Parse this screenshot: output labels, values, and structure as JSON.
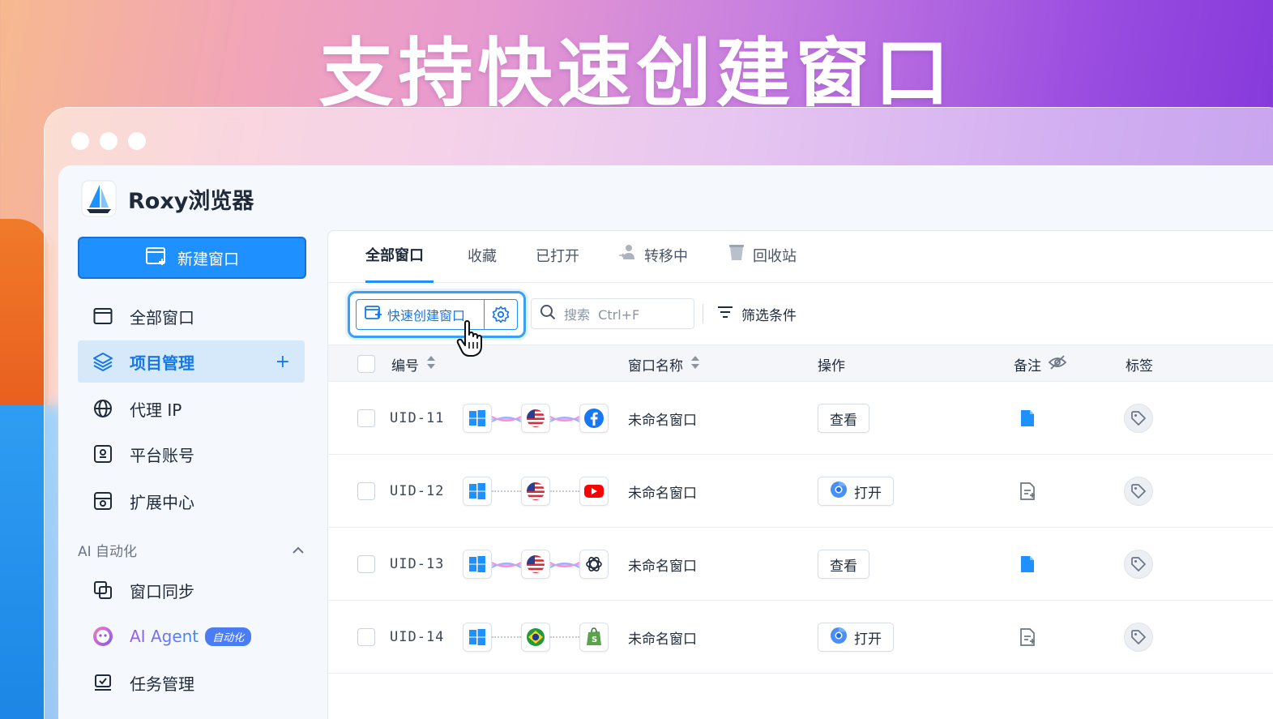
{
  "banner": {
    "headline": "支持快速创建窗口"
  },
  "app": {
    "title": "Roxy浏览器",
    "new_window_label": "新建窗口",
    "nav": [
      {
        "label": "全部窗口",
        "icon": "window-icon"
      },
      {
        "label": "项目管理",
        "icon": "layers-icon",
        "active": true,
        "action": "+"
      },
      {
        "label": "代理 IP",
        "icon": "globe-icon"
      },
      {
        "label": "平台账号",
        "icon": "account-icon"
      },
      {
        "label": "扩展中心",
        "icon": "extension-icon"
      }
    ],
    "section": {
      "label": "AI 自动化"
    },
    "ai_nav": [
      {
        "label": "窗口同步",
        "icon": "sync-icon"
      },
      {
        "label": "AI Agent",
        "icon": "agent-icon",
        "badge": "自动化"
      },
      {
        "label": "任务管理",
        "icon": "task-icon"
      }
    ]
  },
  "tabs": [
    {
      "label": "全部窗口",
      "active": true
    },
    {
      "label": "收藏"
    },
    {
      "label": "已打开"
    },
    {
      "label": "转移中",
      "icon": "transfer-icon"
    },
    {
      "label": "回收站",
      "icon": "trash-icon"
    }
  ],
  "toolbar": {
    "quick_create_label": "快速创建窗口",
    "search_placeholder": "搜索  Ctrl+F",
    "filter_label": "筛选条件"
  },
  "table": {
    "columns": [
      "编号",
      "窗口名称",
      "操作",
      "备注",
      "标签"
    ],
    "rows": [
      {
        "uid": "UID-11",
        "os": "windows",
        "proxy": "us-flag",
        "platform": "facebook",
        "link": "solid",
        "name": "未命名窗口",
        "action": "查看",
        "note": "filled"
      },
      {
        "uid": "UID-12",
        "os": "windows",
        "proxy": "us-flag",
        "platform": "youtube",
        "link": "dotted",
        "name": "未命名窗口",
        "action": "打开",
        "note": "empty"
      },
      {
        "uid": "UID-13",
        "os": "windows",
        "proxy": "us-flag",
        "platform": "openai",
        "link": "solid",
        "name": "未命名窗口",
        "action": "查看",
        "note": "filled"
      },
      {
        "uid": "UID-14",
        "os": "windows",
        "proxy": "brazil-flag",
        "platform": "shopify",
        "link": "dotted",
        "name": "未命名窗口",
        "action": "打开",
        "note": "empty"
      }
    ]
  },
  "colors": {
    "accent": "#1e90ff",
    "active_bg": "#d5e9fb",
    "note_blue": "#1e90ff"
  }
}
